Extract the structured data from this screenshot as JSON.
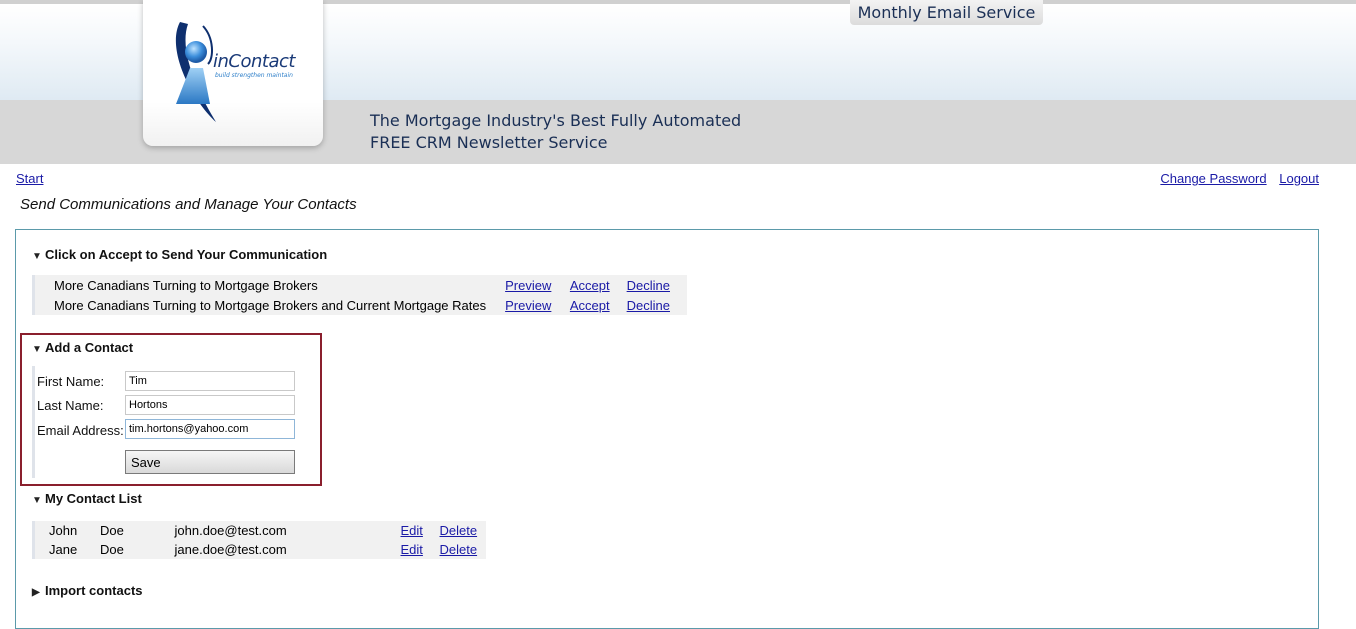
{
  "header": {
    "service_tab": "Monthly Email Service",
    "logo_name": "inContact",
    "logo_tagline": "build strengthen maintain",
    "tagline_line1": "The Mortgage Industry's Best Fully Automated",
    "tagline_line2": "FREE CRM Newsletter Service"
  },
  "nav": {
    "start": "Start",
    "change_password": "Change Password",
    "logout": "Logout"
  },
  "page_title": "Send Communications and Manage Your Contacts",
  "communications": {
    "heading": "Click on Accept to Send Your Communication",
    "rows": [
      {
        "title": "More Canadians Turning to Mortgage Brokers",
        "preview": "Preview",
        "accept": "Accept",
        "decline": "Decline"
      },
      {
        "title": "More Canadians Turning to Mortgage Brokers and Current Mortgage Rates",
        "preview": "Preview",
        "accept": "Accept",
        "decline": "Decline"
      }
    ]
  },
  "add_contact": {
    "heading": "Add a Contact",
    "first_name_label": "First Name:",
    "first_name_value": "Tim",
    "last_name_label": "Last Name:",
    "last_name_value": "Hortons",
    "email_label": "Email Address:",
    "email_value": "tim.hortons@yahoo.com",
    "save_label": "Save"
  },
  "contact_list": {
    "heading": "My Contact List",
    "rows": [
      {
        "first": "John",
        "last": "Doe",
        "email": "john.doe@test.com",
        "edit": "Edit",
        "delete": "Delete"
      },
      {
        "first": "Jane",
        "last": "Doe",
        "email": "jane.doe@test.com",
        "edit": "Edit",
        "delete": "Delete"
      }
    ]
  },
  "import": {
    "heading": "Import contacts"
  },
  "colors": {
    "link": "#1a1aa6",
    "highlight_border": "#8a1f2d",
    "panel_border": "#5b9aaa",
    "header_band": "#d7d7d7",
    "heading_text": "#1a2f55"
  },
  "icons": {
    "expanded": "triangle-down-icon",
    "collapsed": "triangle-right-icon"
  }
}
